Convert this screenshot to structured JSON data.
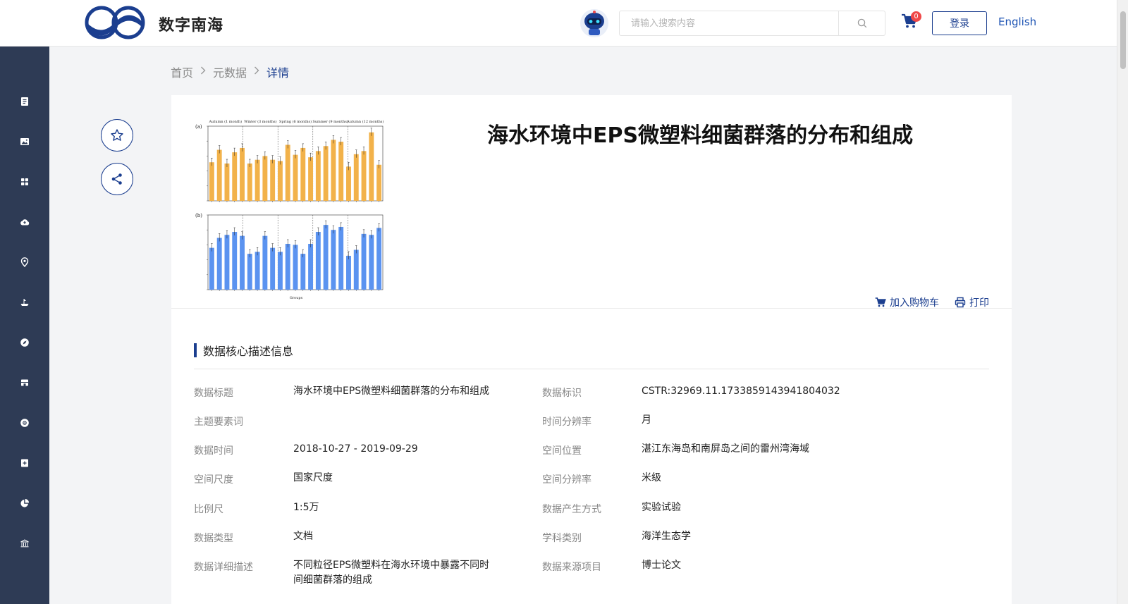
{
  "header": {
    "logo_text": "数字南海",
    "search_placeholder": "请输入搜索内容",
    "cart_count": "0",
    "login_label": "登录",
    "lang_label": "English"
  },
  "sidebar": {
    "icons": [
      "document-icon",
      "image-icon",
      "grid-icon",
      "cloud-upload-icon",
      "location-pin-icon",
      "ship-icon",
      "compass-icon",
      "store-icon",
      "globe-icon",
      "add-box-icon",
      "pie-chart-icon",
      "building-icon"
    ]
  },
  "breadcrumb": {
    "home": "首页",
    "metadata": "元数据",
    "current": "详情"
  },
  "dataset": {
    "title": "海水环境中EPS微塑料细菌群落的分布和组成",
    "add_to_cart": "加入购物车",
    "print": "打印"
  },
  "section": {
    "title": "数据核心描述信息"
  },
  "info": {
    "left": [
      {
        "label": "数据标题",
        "value": "海水环境中EPS微塑料细菌群落的分布和组成"
      },
      {
        "label": "主题要素词",
        "value": ""
      },
      {
        "label": "数据时间",
        "value": "2018-10-27 - 2019-09-29"
      },
      {
        "label": "空间尺度",
        "value": "国家尺度"
      },
      {
        "label": "比例尺",
        "value": "1:5万"
      },
      {
        "label": "数据类型",
        "value": "文档"
      },
      {
        "label": "数据详细描述",
        "value": "不同粒径EPS微塑料在海水环境中暴露不同时间细菌群落的组成"
      }
    ],
    "right": [
      {
        "label": "数据标识",
        "value": "CSTR:32969.11.1733859143941804032"
      },
      {
        "label": "时间分辨率",
        "value": "月"
      },
      {
        "label": "空间位置",
        "value": "湛江东海岛和南屏岛之间的雷州湾海域"
      },
      {
        "label": "空间分辨率",
        "value": "米级"
      },
      {
        "label": "数据产生方式",
        "value": "实验试验"
      },
      {
        "label": "学科类别",
        "value": "海洋生态学"
      },
      {
        "label": "数据来源项目",
        "value": "博士论文"
      }
    ]
  },
  "thumbnail": {
    "top_labels": [
      "Autumn (1 month)",
      "Winter (3 months)",
      "Spring (6 months)",
      "Summer (9 months)",
      "Autumn (12 months)"
    ],
    "panel_a": "(a)",
    "panel_b": "(b)",
    "xlabel": "Groups",
    "top_values": [
      0.62,
      0.82,
      0.6,
      0.78,
      0.85,
      0.6,
      0.66,
      0.72,
      0.66,
      0.64,
      0.9,
      0.74,
      0.85,
      0.7,
      0.8,
      0.88,
      0.98,
      0.95,
      0.55,
      0.75,
      0.8,
      1.1,
      0.58
    ],
    "bottom_values": [
      0.42,
      0.52,
      0.55,
      0.58,
      0.54,
      0.36,
      0.38,
      0.54,
      0.42,
      0.38,
      0.46,
      0.45,
      0.36,
      0.46,
      0.58,
      0.65,
      0.6,
      0.63,
      0.34,
      0.4,
      0.56,
      0.55,
      0.62
    ],
    "colors": {
      "top": "#f2b24a",
      "bottom": "#5b93f0"
    }
  }
}
